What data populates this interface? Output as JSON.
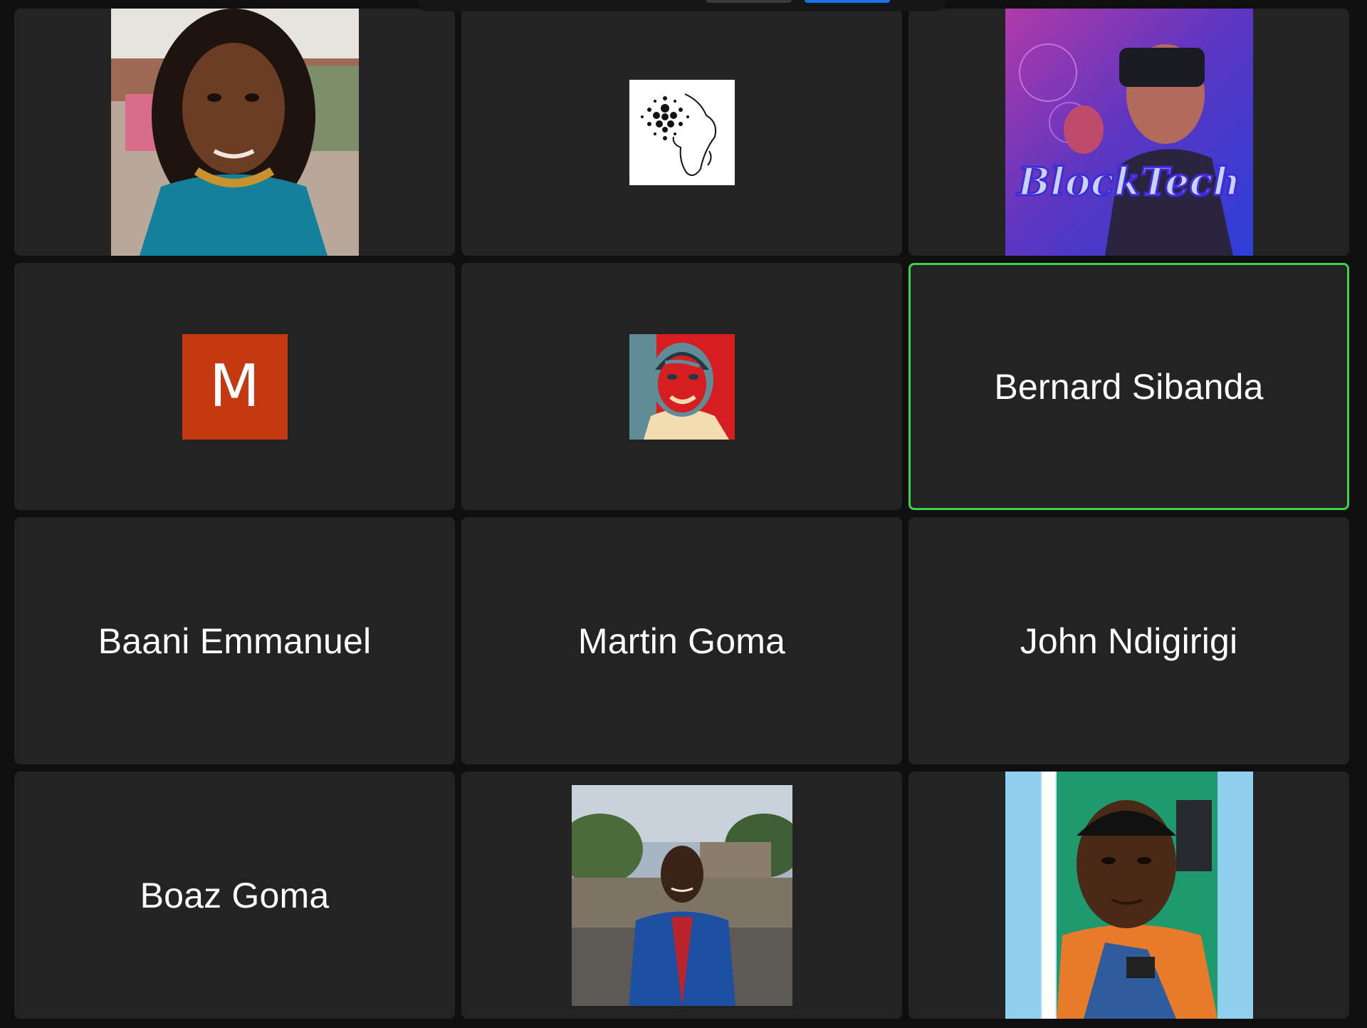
{
  "toolbar": {
    "accent": "#1a73e8"
  },
  "grid": {
    "active_border_color": "#3fd24a",
    "tiles": [
      {
        "kind": "photo",
        "subject": "participant-photo-woman-braids"
      },
      {
        "kind": "photo",
        "subject": "participant-logo-cardano-africa"
      },
      {
        "kind": "photo",
        "subject": "participant-photo-blocktech-vr",
        "overlay_text": "BlockTech"
      },
      {
        "kind": "avatar-letter",
        "letter": "M",
        "color": "#c4390f"
      },
      {
        "kind": "photo",
        "subject": "participant-poster-portrait"
      },
      {
        "kind": "name",
        "name": "Bernard Sibanda",
        "active_speaker": true
      },
      {
        "kind": "name",
        "name": "Baani Emmanuel"
      },
      {
        "kind": "name",
        "name": "Martin Goma"
      },
      {
        "kind": "name",
        "name": "John Ndigirigi"
      },
      {
        "kind": "name",
        "name": "Boaz Goma"
      },
      {
        "kind": "photo",
        "subject": "participant-photo-man-blue-suit"
      },
      {
        "kind": "photo",
        "subject": "participant-photo-man-orange-shirt"
      }
    ]
  }
}
